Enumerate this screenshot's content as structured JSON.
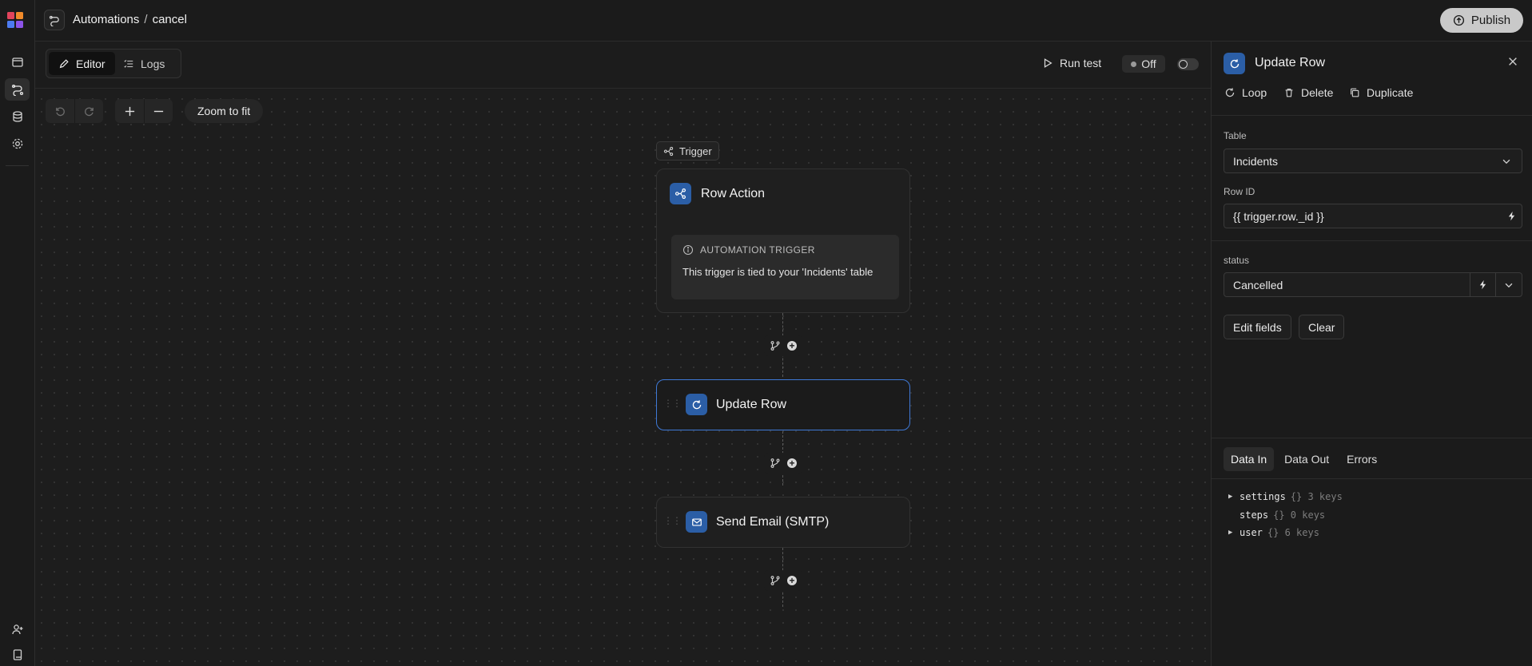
{
  "app": {
    "breadcrumb_root": "Automations",
    "breadcrumb_separator": "/",
    "breadcrumb_current": "cancel",
    "publish_label": "Publish"
  },
  "rail": {
    "items": [
      "apps-icon",
      "automations-icon",
      "data-icon",
      "settings-icon"
    ],
    "bottom_items": [
      "add-user-icon",
      "docs-icon"
    ]
  },
  "toolbar": {
    "tabs": [
      {
        "label": "Editor",
        "icon": "pencil-icon",
        "active": true
      },
      {
        "label": "Logs",
        "icon": "list-icon",
        "active": false
      }
    ],
    "run_test_label": "Run test",
    "status_label": "Off",
    "zoom_to_fit_label": "Zoom to fit"
  },
  "flow": {
    "trigger_badge": "Trigger",
    "steps": [
      {
        "title": "Row Action",
        "icon": "branch-icon",
        "type": "trigger"
      },
      {
        "title": "Update Row",
        "icon": "refresh-icon",
        "type": "action",
        "selected": true
      },
      {
        "title": "Send Email (SMTP)",
        "icon": "mail-icon",
        "type": "action"
      }
    ],
    "trigger_info": {
      "heading": "AUTOMATION TRIGGER",
      "text": "This trigger is tied to your 'Incidents' table"
    }
  },
  "panel": {
    "title": "Update Row",
    "actions": [
      {
        "label": "Loop",
        "icon": "loop-icon"
      },
      {
        "label": "Delete",
        "icon": "trash-icon"
      },
      {
        "label": "Duplicate",
        "icon": "copy-icon"
      }
    ],
    "table_label": "Table",
    "table_value": "Incidents",
    "row_id_label": "Row ID",
    "row_id_value": "{{ trigger.row._id }}",
    "status_label": "status",
    "status_value": "Cancelled",
    "edit_fields_label": "Edit fields",
    "clear_label": "Clear",
    "data_tabs": [
      "Data In",
      "Data Out",
      "Errors"
    ],
    "tree": [
      {
        "key": "settings",
        "meta": "{} 3 keys",
        "expandable": true
      },
      {
        "key": "steps",
        "meta": "{} 0 keys",
        "expandable": false
      },
      {
        "key": "user",
        "meta": "{} 6 keys",
        "expandable": true
      }
    ]
  },
  "colors": {
    "accent_blue": "#2b5ea6",
    "selected_border": "#3f79d6",
    "background": "#1c1c1c",
    "logo_red": "#e2445c",
    "logo_orange": "#f08a2a",
    "logo_blue": "#4d7bf0",
    "logo_purple": "#8c54e8"
  }
}
